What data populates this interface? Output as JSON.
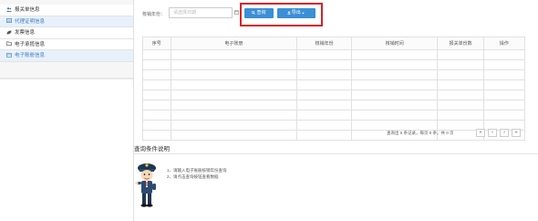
{
  "sidebar": {
    "items": [
      {
        "label": "报关单信息",
        "icon": "users-icon",
        "active": false
      },
      {
        "label": "代理证明信息",
        "icon": "document-icon",
        "active": true
      },
      {
        "label": "发票信息",
        "icon": "leaf-icon",
        "active": false
      },
      {
        "label": "电子承揽信息",
        "icon": "folder-icon",
        "active": false
      },
      {
        "label": "电子账册信息",
        "icon": "archive-icon",
        "active": true
      }
    ]
  },
  "filter": {
    "label": "核销年份：",
    "placeholder": "请选择日期"
  },
  "toolbar": {
    "query_label": "查询",
    "export_label": "导出"
  },
  "table": {
    "columns": [
      "序号",
      "电子账册",
      "核销年份",
      "核销时间",
      "报关单份数",
      "操作"
    ]
  },
  "pager": {
    "info": "查询出 0 条记录，每页 0 条，共 0 页",
    "first": "«",
    "prev": "‹",
    "next": "›",
    "last": "»"
  },
  "help": {
    "title": "查询条件说明",
    "notes": [
      "1、请输入电子账册核销年份查询",
      "2、请点击查询按钮查看数据"
    ]
  },
  "colors": {
    "accent": "#3b8fd5",
    "highlight": "#d6232a",
    "active_bg": "#e8f1fb"
  }
}
